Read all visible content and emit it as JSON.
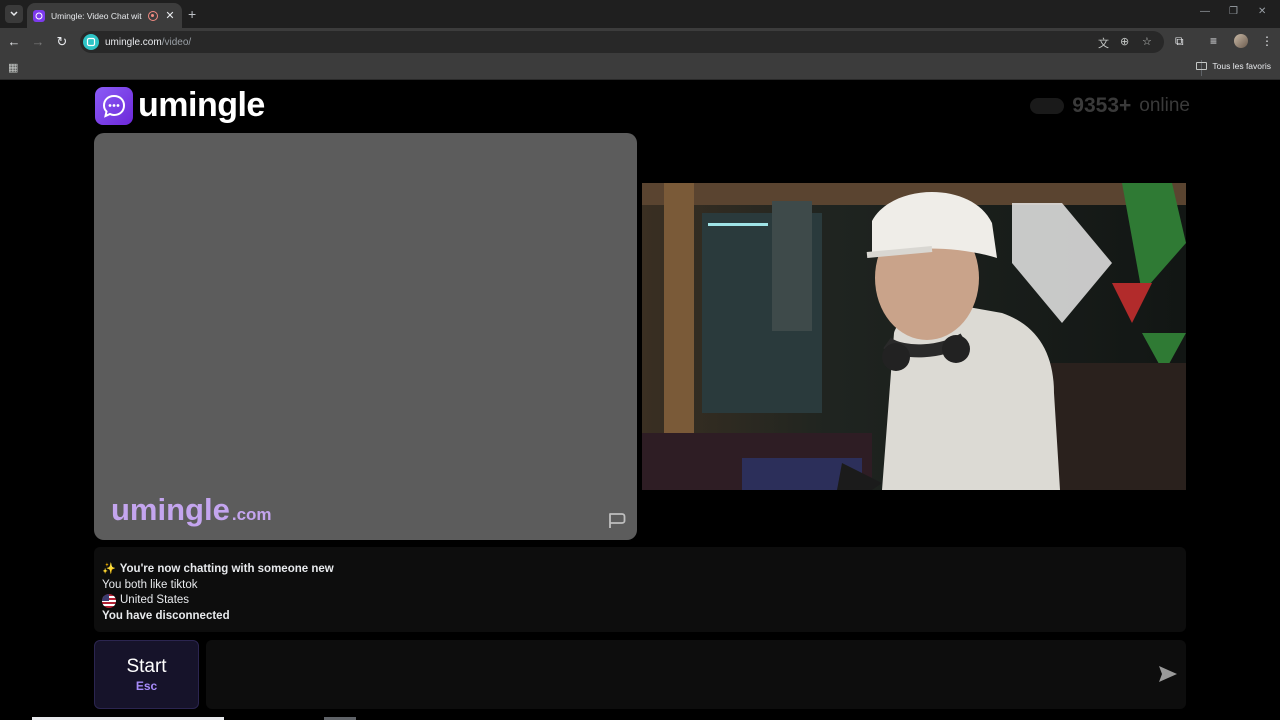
{
  "browser": {
    "tab_title": "Umingle: Video Chat with S",
    "tab_close": "✕",
    "new_tab": "+",
    "url_host": "umingle.com",
    "url_path": "/video/",
    "bookmarks_folder": "Tous les favoris"
  },
  "header": {
    "logo_text": "umingle",
    "online_count": "9353+",
    "online_label": "online"
  },
  "video": {
    "watermark_main": "umingle",
    "watermark_suffix": ".com"
  },
  "chat": {
    "messages": [
      {
        "icon": "sparkle-icon",
        "text": "You're now chatting with someone new",
        "bold": true
      },
      {
        "text": "You both like tiktok",
        "bold": false
      },
      {
        "icon": "us-flag-icon",
        "text": "United States",
        "bold": false
      },
      {
        "text": "You have disconnected",
        "bold": true
      }
    ]
  },
  "controls": {
    "start_label": "Start",
    "start_shortcut": "Esc",
    "message_placeholder": ""
  },
  "colors": {
    "brand": "#7c3aed",
    "watermark": "#c4a5ef",
    "start_accent": "#a78bfa"
  }
}
